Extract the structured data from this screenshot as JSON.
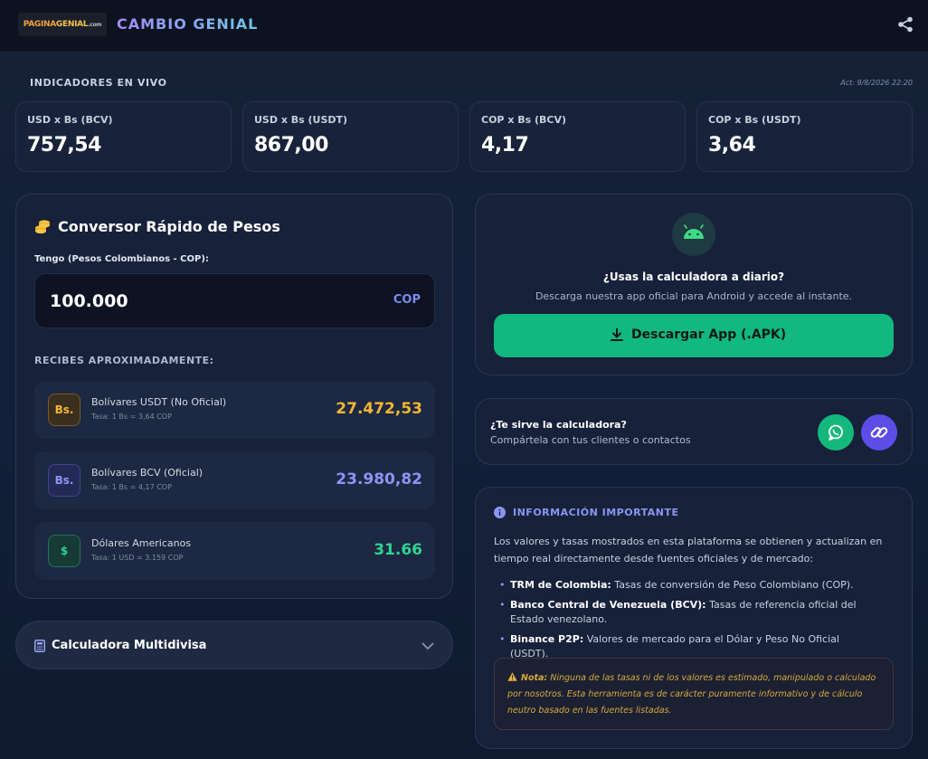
{
  "header": {
    "logo_text_a": "PAGINA",
    "logo_text_b": "GENIAL",
    "logo_text_c": ".com",
    "title": "CAMBIO GENIAL"
  },
  "indicators": {
    "label": "INDICADORES EN VIVO",
    "updated": "Act: 9/8/2026 22:20",
    "cards": [
      {
        "label": "USD x Bs (BCV)",
        "value": "757,54"
      },
      {
        "label": "USD x Bs (USDT)",
        "value": "867,00"
      },
      {
        "label": "COP x Bs (BCV)",
        "value": "4,17"
      },
      {
        "label": "COP x Bs (USDT)",
        "value": "3,64"
      }
    ]
  },
  "converter": {
    "title": "Conversor Rápido de Pesos",
    "have_label": "Tengo (Pesos Colombianos - COP):",
    "amount": "100.000",
    "currency": "COP",
    "receive_label": "RECIBES APROXIMADAMENTE:",
    "results": [
      {
        "badge": "Bs.",
        "name": "Bolívares USDT (No Oficial)",
        "rate": "Tasa: 1 Bs = 3,64 COP",
        "amount": "27.472,53"
      },
      {
        "badge": "Bs.",
        "name": "Bolívares BCV (Oficial)",
        "rate": "Tasa: 1 Bs = 4,17 COP",
        "amount": "23.980,82"
      },
      {
        "badge": "$",
        "name": "Dólares Americanos",
        "rate": "Tasa: 1 USD = 3.159 COP",
        "amount": "31.66"
      }
    ],
    "colors": {
      "usdt": "#f2b733",
      "bcv": "#8e94f5",
      "usd": "#2fd391"
    }
  },
  "multi": {
    "label": "Calculadora Multidivisa"
  },
  "app_promo": {
    "question": "¿Usas la calculadora a diario?",
    "subtitle": "Descarga nuestra app oficial para Android y accede al instante.",
    "button": "Descargar App (.APK)"
  },
  "share": {
    "question": "¿Te sirve la calculadora?",
    "subtitle": "Compártela con tus clientes o contactos"
  },
  "info": {
    "title": "INFORMACIÓN IMPORTANTE",
    "paragraph": "Los valores y tasas mostrados en esta plataforma se obtienen y actualizan en tiempo real directamente desde fuentes oficiales y de mercado:",
    "bullets": [
      {
        "term": "TRM de Colombia:",
        "text": " Tasas de conversión de Peso Colombiano (COP)."
      },
      {
        "term": "Banco Central de Venezuela (BCV):",
        "text": " Tasas de referencia oficial del Estado venezolano."
      },
      {
        "term": "Binance P2P:",
        "text": " Valores de mercado para el Dólar y Peso No Oficial (USDT)."
      }
    ],
    "note_term": "Nota:",
    "note_text": " Ninguna de las tasas ni de los valores es estimado, manipulado o calculado por nosotros. Esta herramienta es de carácter puramente informativo y de cálculo neutro basado en las fuentes listadas."
  }
}
